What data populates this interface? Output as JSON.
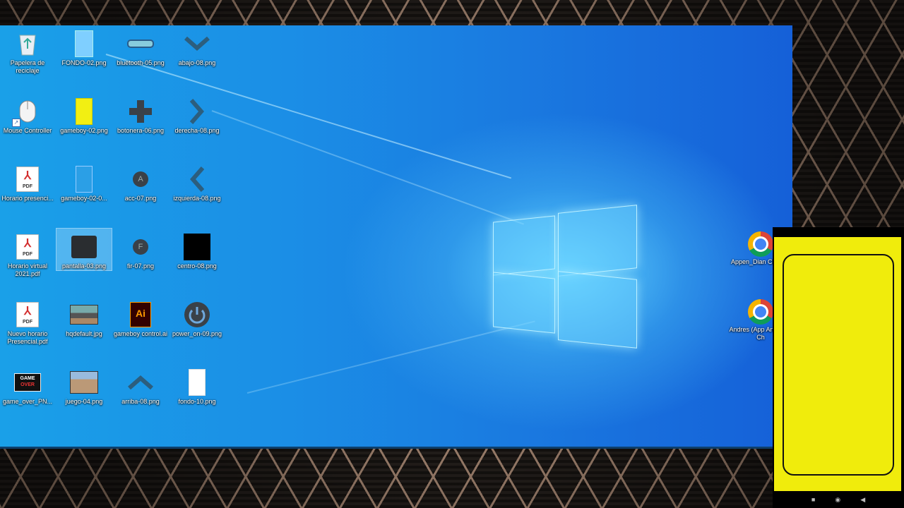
{
  "desktop_icons": [
    {
      "label": "Papelera de reciclaje",
      "icon": "recycle-bin-icon"
    },
    {
      "label": "FONDO-02.png",
      "icon": "image-file-icon"
    },
    {
      "label": "bluetooth-05.png",
      "icon": "image-file-icon"
    },
    {
      "label": "abajo-08.png",
      "icon": "down-arrow-icon"
    },
    {
      "label": "Mouse Controller",
      "icon": "mouse-icon"
    },
    {
      "label": "gameboy-02.png",
      "icon": "image-file-icon"
    },
    {
      "label": "botonera-06.png",
      "icon": "dpad-icon"
    },
    {
      "label": "derecha-08.png",
      "icon": "right-arrow-icon"
    },
    {
      "label": "Horario presenci...",
      "icon": "pdf-icon"
    },
    {
      "label": "gameboy-02-0...",
      "icon": "image-file-icon"
    },
    {
      "label": "acc-07.png",
      "icon": "a-button-icon"
    },
    {
      "label": "izquierda-08.png",
      "icon": "left-arrow-icon"
    },
    {
      "label": "Horario virtual 2021.pdf",
      "icon": "pdf-icon"
    },
    {
      "label": "pantalla-03.png",
      "icon": "image-file-icon"
    },
    {
      "label": "fir-07.png",
      "icon": "f-button-icon"
    },
    {
      "label": "centro-08.png",
      "icon": "image-file-icon"
    },
    {
      "label": "Nuevo horario Presencial.pdf",
      "icon": "pdf-icon"
    },
    {
      "label": "hqdefault.jpg",
      "icon": "image-file-icon"
    },
    {
      "label": "gameboy control.ai",
      "icon": "illustrator-icon"
    },
    {
      "label": "power_on-09.png",
      "icon": "power-icon"
    },
    {
      "label": "game_over_PN...",
      "icon": "image-file-icon"
    },
    {
      "label": "juego-04.png",
      "icon": "image-file-icon"
    },
    {
      "label": "arriba-08.png",
      "icon": "up-arrow-icon"
    },
    {
      "label": "fondo-10.png",
      "icon": "image-file-icon"
    }
  ],
  "right_icons": [
    {
      "label": "Appen_Dian Chrome",
      "icon": "chrome-icon"
    },
    {
      "label": "Andres (App Andres) - Ch",
      "icon": "chrome-icon"
    }
  ],
  "logo_text": {
    "gameover_line1": "GAME",
    "gameover_line2": "OVER",
    "ai": "Ai",
    "pdf_tag": "PDF"
  },
  "phone": {
    "nav": [
      "■",
      "◉",
      "◀"
    ]
  },
  "colors": {
    "phone_screen": "#f0ec0c",
    "desktop_blue": "#1a86e4"
  }
}
